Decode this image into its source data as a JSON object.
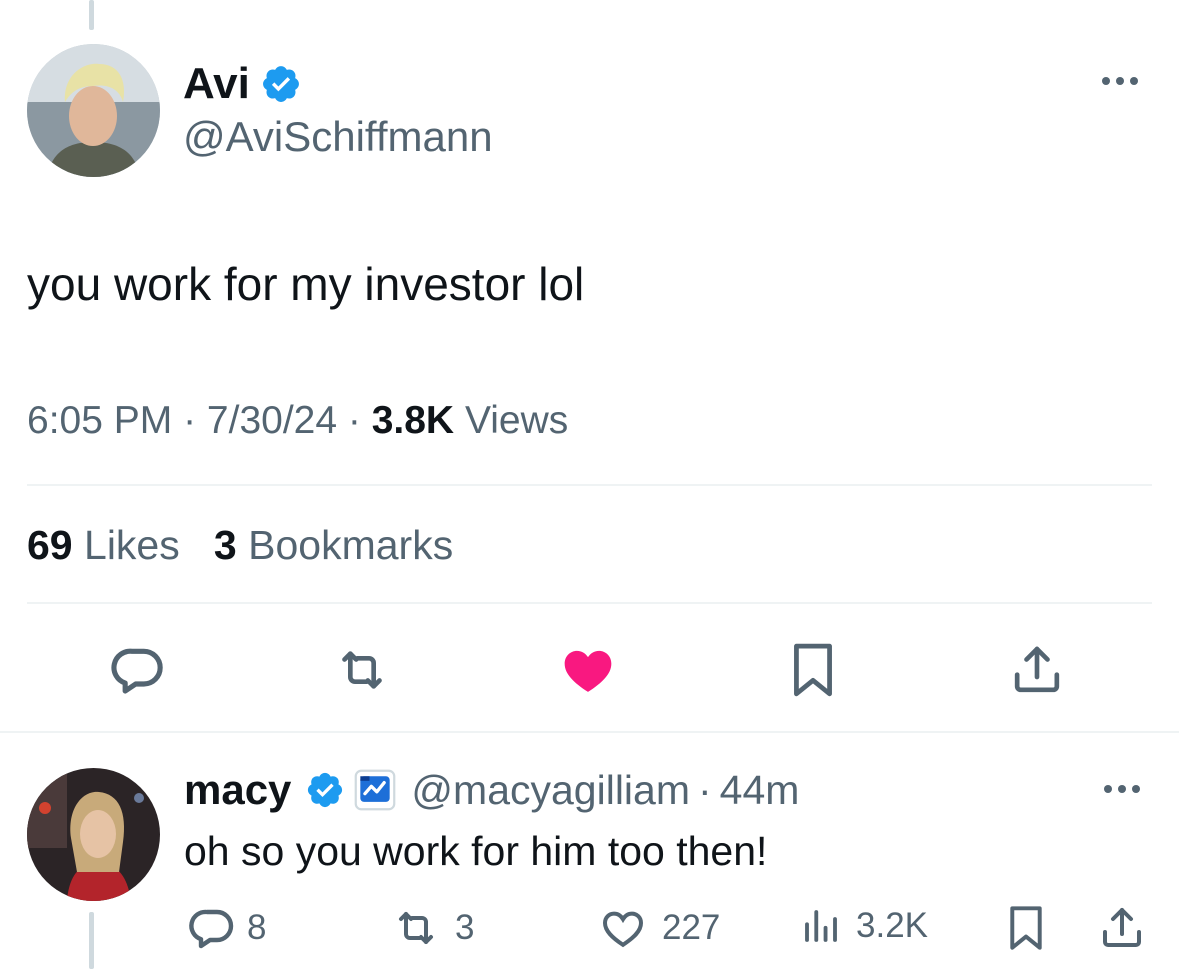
{
  "tweet": {
    "author_name": "Avi",
    "author_handle": "@AviSchiffmann",
    "text": "you work for my investor lol",
    "time": "6:05 PM",
    "date": "7/30/24",
    "views_count": "3.8K",
    "views_label": "Views",
    "likes_count": "69",
    "likes_label": "Likes",
    "bookmarks_count": "3",
    "bookmarks_label": "Bookmarks"
  },
  "reply": {
    "author_name": "macy",
    "author_handle": "@macyagilliam",
    "age": "44m",
    "text": "oh so you work for him too then!",
    "replies": "8",
    "reposts": "3",
    "likes": "227",
    "views": "3.2K"
  },
  "colors": {
    "verified": "#1d9bf0",
    "like_active": "#f91880",
    "secondary_text": "#536471",
    "icon": "#536471"
  },
  "icons": [
    "verified-badge-icon",
    "more-icon",
    "reply-icon",
    "repost-icon",
    "heart-filled-icon",
    "bookmark-icon",
    "share-icon",
    "heart-outline-icon",
    "views-icon",
    "affiliate-badge-icon"
  ]
}
